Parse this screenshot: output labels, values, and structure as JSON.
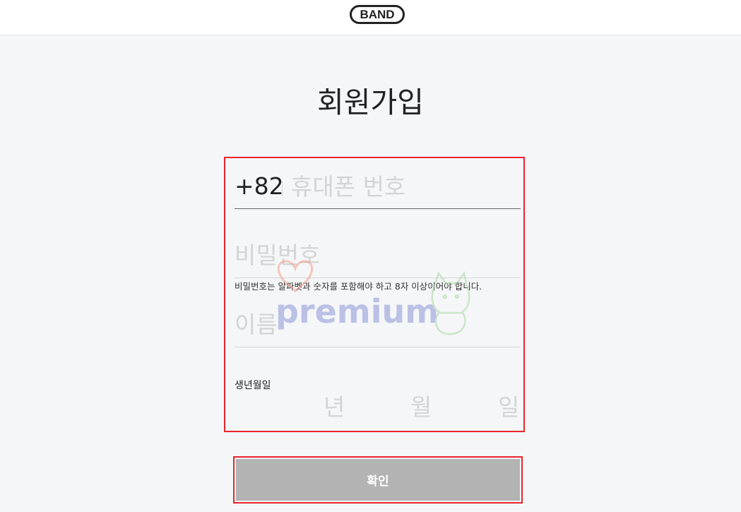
{
  "header": {
    "logo_text": "BAND"
  },
  "page": {
    "title": "회원가입"
  },
  "form": {
    "country_code": "+82",
    "phone_placeholder": "휴대폰 번호",
    "password_placeholder": "비밀번호",
    "password_hint": "비밀번호는 알파벳과 숫자를 포함해야 하고 8자 이상이어야 합니다.",
    "name_placeholder": "이름",
    "birth_label": "생년월일",
    "birth_year_unit": "년",
    "birth_month_unit": "월",
    "birth_day_unit": "일"
  },
  "actions": {
    "confirm_label": "확인"
  },
  "watermark": {
    "text": "premium"
  },
  "colors": {
    "background": "#f5f6f8",
    "highlight_border": "#e8252a",
    "button_disabled": "#b3b3b3"
  }
}
